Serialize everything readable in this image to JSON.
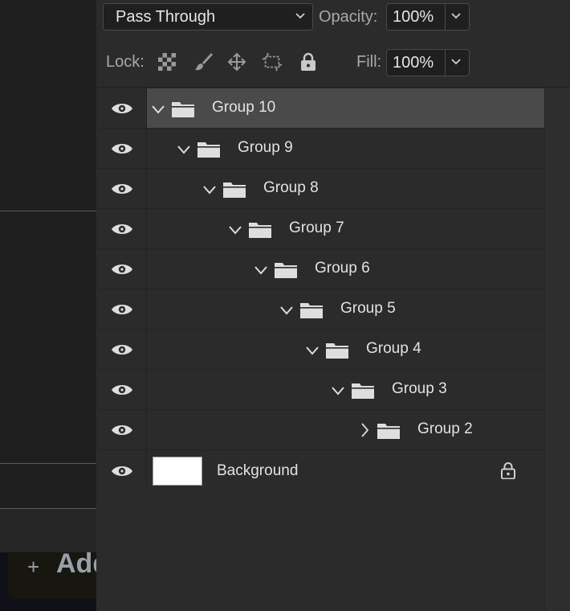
{
  "left": {
    "add_label": "Add",
    "add_icon": "plus-icon"
  },
  "toolbar": {
    "blend_mode": "Pass Through",
    "opacity_label": "Opacity:",
    "opacity_value": "100%",
    "lock_label": "Lock:",
    "lock_icons": [
      "lock-transparent-pixels-icon",
      "lock-image-pixels-icon",
      "lock-position-icon",
      "lock-artboard-icon",
      "lock-all-icon"
    ],
    "fill_label": "Fill:",
    "fill_value": "100%"
  },
  "layers": [
    {
      "name": "Group 10",
      "level": 0,
      "expanded": true,
      "selected": true
    },
    {
      "name": "Group 9",
      "level": 1,
      "expanded": true
    },
    {
      "name": "Group 8",
      "level": 2,
      "expanded": true
    },
    {
      "name": "Group 7",
      "level": 3,
      "expanded": true
    },
    {
      "name": "Group 6",
      "level": 4,
      "expanded": true
    },
    {
      "name": "Group 5",
      "level": 5,
      "expanded": true
    },
    {
      "name": "Group 4",
      "level": 6,
      "expanded": true
    },
    {
      "name": "Group 3",
      "level": 7,
      "expanded": true
    },
    {
      "name": "Group 2",
      "level": 8,
      "expanded": false
    },
    {
      "name": "Background",
      "level": 0,
      "locked": true,
      "thumbnail": "white"
    }
  ],
  "colors": {
    "panel_bg": "#2b2b2b",
    "selected_row": "#4a4a4a",
    "text": "#e2e2e2"
  }
}
